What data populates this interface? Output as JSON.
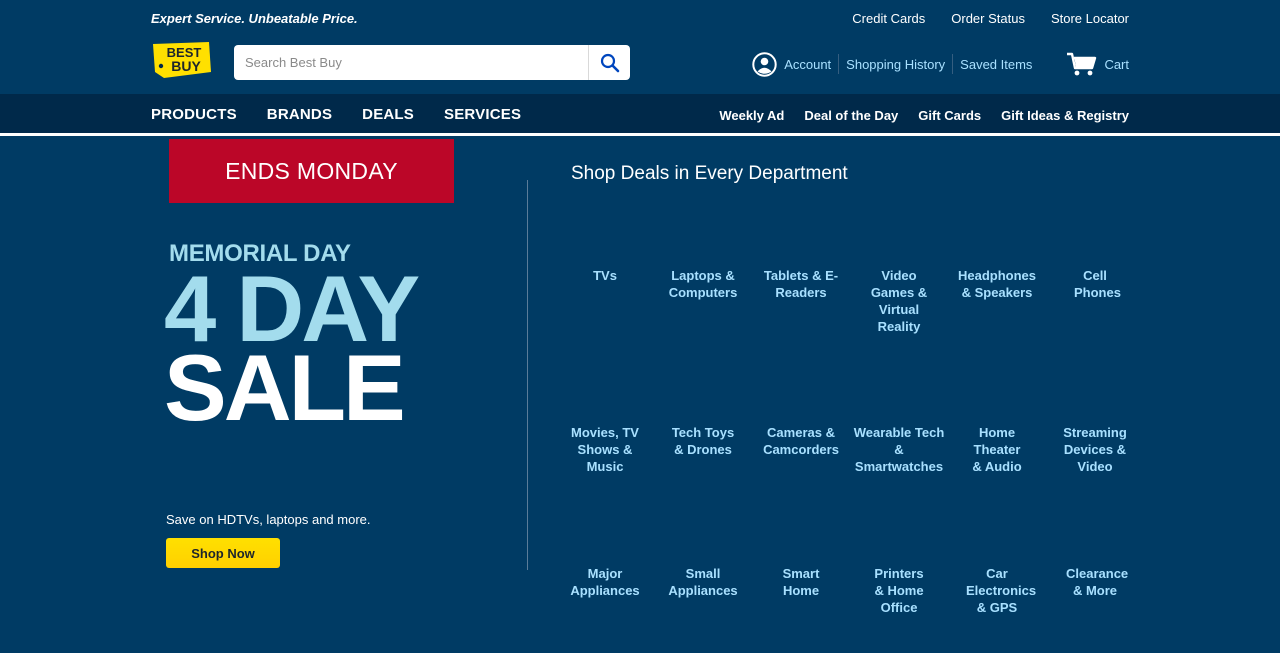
{
  "header": {
    "tagline": "Expert Service. Unbeatable Price.",
    "util_links": [
      "Credit Cards",
      "Order Status",
      "Store Locator"
    ],
    "logo_text_line1": "BEST",
    "logo_text_line2": "BUY",
    "search": {
      "placeholder": "Search Best Buy"
    },
    "account": {
      "account_label": "Account",
      "history_label": "Shopping History",
      "saved_label": "Saved Items",
      "cart_label": "Cart"
    }
  },
  "nav": {
    "primary": [
      "PRODUCTS",
      "BRANDS",
      "DEALS",
      "SERVICES"
    ],
    "secondary": [
      "Weekly Ad",
      "Deal of the Day",
      "Gift Cards",
      "Gift Ideas & Registry"
    ]
  },
  "hero": {
    "banner": "ENDS MONDAY",
    "kicker": "MEMORIAL DAY",
    "line1": "4 DAY",
    "line2": "SALE",
    "subtext": "Save on HDTVs, laptops and more.",
    "cta": "Shop Now"
  },
  "departments": {
    "title": "Shop Deals in Every Department",
    "rows": [
      [
        "TVs",
        "Laptops & Computers",
        "Tablets & E-Readers",
        "Video Games & Virtual Reality",
        "Headphones & Speakers",
        "Cell Phones"
      ],
      [
        "Movies, TV Shows & Music",
        "Tech Toys & Drones",
        "Cameras & Camcorders",
        "Wearable Tech & Smartwatches",
        "Home Theater & Audio",
        "Streaming Devices & Video"
      ],
      [
        "Major Appliances",
        "Small Appliances",
        "Smart Home",
        "Printers & Home Office",
        "Car Electronics & GPS",
        "Clearance & More"
      ]
    ]
  },
  "colors": {
    "background": "#003b64",
    "navbar": "#00294a",
    "accent_red": "#bb0628",
    "accent_yellow": "#ffe000",
    "link_light_blue": "#a8e0ff",
    "hero_light_blue": "#a3dced"
  },
  "icons": {
    "search": "search-icon",
    "account": "user-circle-icon",
    "cart": "cart-icon"
  }
}
